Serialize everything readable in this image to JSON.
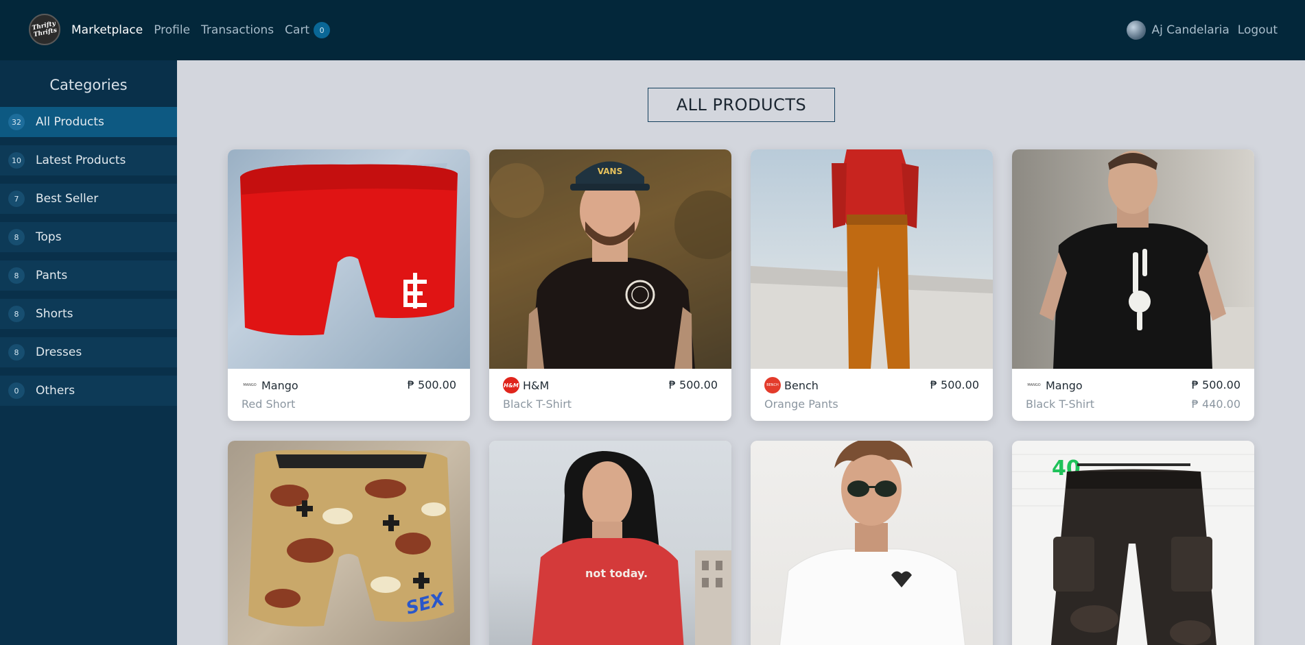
{
  "navbar": {
    "logo_text": "Thrifty Thrifts",
    "links": [
      {
        "label": "Marketplace"
      },
      {
        "label": "Profile"
      },
      {
        "label": "Transactions"
      },
      {
        "label": "Cart"
      }
    ],
    "cart_count": "0",
    "user_name": "Aj Candelaria",
    "logout_label": "Logout"
  },
  "sidebar": {
    "title": "Categories",
    "items": [
      {
        "count": "32",
        "label": "All Products"
      },
      {
        "count": "10",
        "label": "Latest Products"
      },
      {
        "count": "7",
        "label": "Best Seller"
      },
      {
        "count": "8",
        "label": "Tops"
      },
      {
        "count": "8",
        "label": "Pants"
      },
      {
        "count": "8",
        "label": "Shorts"
      },
      {
        "count": "8",
        "label": "Dresses"
      },
      {
        "count": "0",
        "label": "Others"
      }
    ]
  },
  "main": {
    "heading": "ALL PRODUCTS",
    "products": [
      {
        "brand": "Mango",
        "price": "₱ 500.00",
        "name": "Red Short",
        "old_price": ""
      },
      {
        "brand": "H&M",
        "price": "₱ 500.00",
        "name": "Black T-Shirt",
        "old_price": ""
      },
      {
        "brand": "Bench",
        "price": "₱ 500.00",
        "name": "Orange Pants",
        "old_price": ""
      },
      {
        "brand": "Mango",
        "price": "₱ 500.00",
        "name": "Black T-Shirt",
        "old_price": "₱ 440.00"
      }
    ],
    "shirt_print_text": "not today.",
    "brand_logo_text": {
      "mango": "MANGO",
      "hm": "H&M",
      "bench": "BENCH"
    }
  },
  "colors": {
    "navbar_bg": "#03273a",
    "sidebar_bg": "#09304a",
    "active_category": "#0d5982",
    "page_bg": "#d3d6dd"
  }
}
